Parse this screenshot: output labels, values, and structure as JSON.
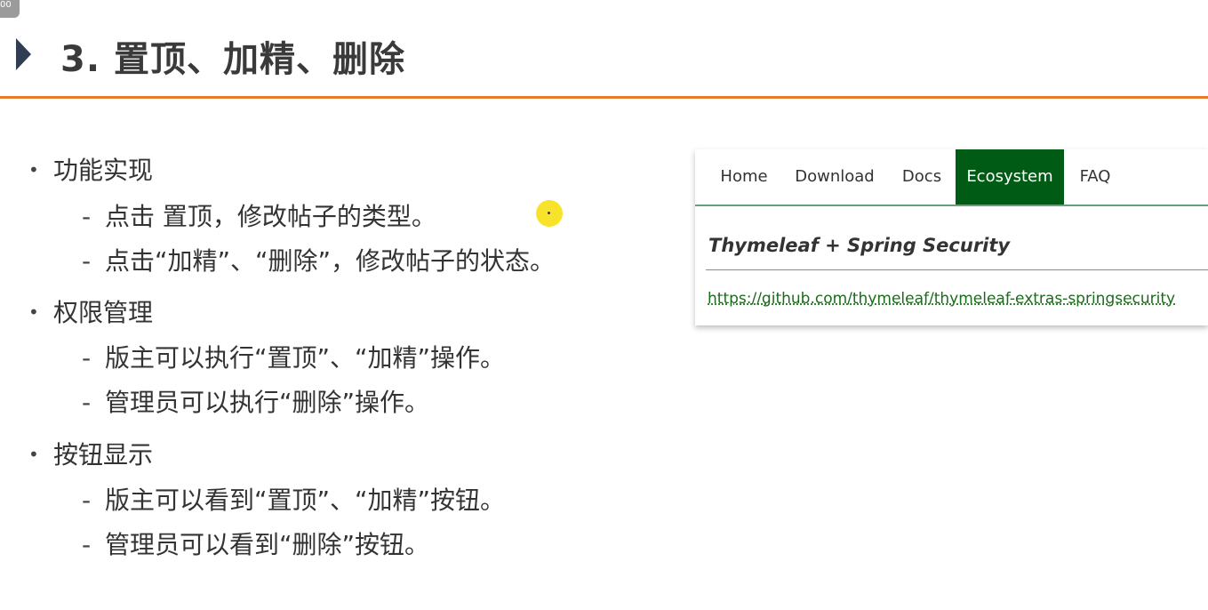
{
  "corner_badge": "00",
  "slide": {
    "title": "3. 置顶、加精、删除"
  },
  "bullets": [
    {
      "text": "功能实现",
      "children": [
        "点击 置顶，修改帖子的类型。",
        "点击“加精”、“删除”，修改帖子的状态。"
      ]
    },
    {
      "text": "权限管理",
      "children": [
        "版主可以执行“置顶”、“加精”操作。",
        "管理员可以执行“删除”操作。"
      ]
    },
    {
      "text": "按钮显示",
      "children": [
        "版主可以看到“置顶”、“加精”按钮。",
        "管理员可以看到“删除”按钮。"
      ]
    }
  ],
  "embed": {
    "nav": [
      "Home",
      "Download",
      "Docs",
      "Ecosystem",
      "FAQ"
    ],
    "active_nav": "Ecosystem",
    "heading": "Thymeleaf + Spring Security",
    "link": "https://github.com/thymeleaf/thymeleaf-extras-springsecurity"
  },
  "colors": {
    "accent_rule": "#e87a2e",
    "nav_active_bg": "#005c14",
    "link": "#1a6b1a",
    "cursor_highlight": "#f8e11f"
  }
}
